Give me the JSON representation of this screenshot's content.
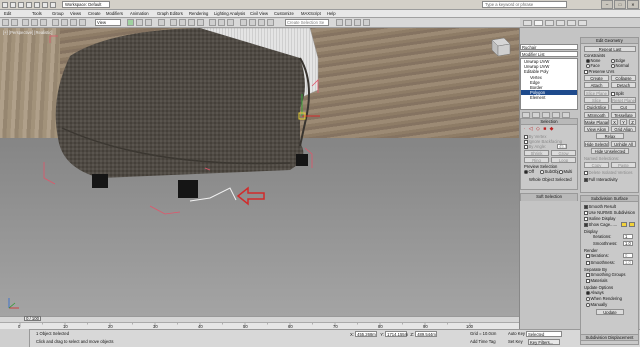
{
  "titlebar": {
    "workspace": "Workspace: Default",
    "title": "",
    "search_placeholder": "Type a keyword or phrase",
    "win_buttons": [
      "–",
      "□",
      "✕"
    ]
  },
  "menu": [
    "Edit",
    "Tools",
    "Group",
    "Views",
    "Create",
    "Modifiers",
    "Animation",
    "Graph Editors",
    "Rendering",
    "Lighting Analysis",
    "Civil View",
    "Customize",
    "MAXScript",
    "Help"
  ],
  "toolbar": {
    "view_dropdown": "View",
    "selection_set": "Create Selection Se"
  },
  "viewport": {
    "label": "[+] [Perspective] [Realistic]"
  },
  "time": {
    "slider_label": "0 / 100",
    "ruler_ticks": [
      "0",
      "10",
      "20",
      "30",
      "40",
      "50",
      "60",
      "70",
      "80",
      "90",
      "100"
    ]
  },
  "status": {
    "objects_selected": "1 Object Selected",
    "prompt": "Click and drag to select and move objects",
    "x_label": "X:",
    "x_value": "455.268m",
    "y_label": "Y:",
    "y_value": "1714.155m",
    "z_label": "Z:",
    "z_value": "489.544m",
    "grid": "Grid = 10.0cm",
    "add_time_tag": "Add Time Tag",
    "auto_key": "Auto Key",
    "auto_key_value": "Selected",
    "set_key": "Set Key",
    "key_filters": "Key Filters...",
    "frame": "0"
  },
  "panel": {
    "object_name": "Ruchair",
    "modifier_list": "Modifier List",
    "stack": [
      {
        "label": "Unwrap UVW",
        "selected": false,
        "indent": 0
      },
      {
        "label": "Unwrap UVW",
        "selected": false,
        "indent": 0
      },
      {
        "label": "Editable Poly",
        "selected": false,
        "indent": 0
      },
      {
        "label": "Vertex",
        "selected": false,
        "indent": 1
      },
      {
        "label": "Edge",
        "selected": false,
        "indent": 1
      },
      {
        "label": "Border",
        "selected": false,
        "indent": 1
      },
      {
        "label": "Polygon",
        "selected": true,
        "indent": 1
      },
      {
        "label": "Element",
        "selected": false,
        "indent": 1
      }
    ],
    "edit_geometry": {
      "header": "Edit Geometry",
      "repeat_last": "Repeat Last",
      "constraints": "Constraints",
      "none": "None",
      "edge": "Edge",
      "face": "Face",
      "normal": "Normal",
      "preserve_uvs": "Preserve UVs",
      "create": "Create",
      "collapse": "Collapse",
      "attach": "Attach",
      "detach": "Detach",
      "slice_plane": "Slice Plane",
      "split": "Split",
      "slice": "Slice",
      "reset_plane": "Reset Plane",
      "quickslice": "QuickSlice",
      "cut": "Cut",
      "msmooth": "MSmooth",
      "tessellate": "Tessellate",
      "make_planar": "Make Planar",
      "x": "X",
      "y": "Y",
      "z": "Z",
      "view_align": "View Align",
      "grid_align": "Grid Align",
      "relax": "Relax",
      "hide_selected": "Hide Selected",
      "unhide_all": "Unhide All",
      "hide_unselected": "Hide Unselected",
      "named_selections": "Named Selections:",
      "copy": "Copy",
      "paste": "Paste",
      "delete_isolated": "Delete Isolated Vertices",
      "full_interactivity": "Full Interactivity"
    },
    "selection": {
      "header": "Selection",
      "by_vertex": "By Vertex",
      "ignore_backfacing": "Ignore Backfacing",
      "by_angle": "By Angle:",
      "angle_value": "45.0",
      "shrink": "Shrink",
      "grow": "Grow",
      "ring": "Ring",
      "loop": "Loop",
      "preview_selection": "Preview Selection",
      "off": "Off",
      "subobj": "SubObj",
      "multi": "Multi",
      "whole_object": "Whole Object Selected"
    },
    "soft_selection": "Soft Selection",
    "subdivision": {
      "header": "Subdivision Surface",
      "smooth_result": "Smooth Result",
      "use_nurms": "Use NURMS Subdivision",
      "isoline": "Isoline Display",
      "show_cage": "Show Cage......",
      "display": "Display",
      "iterations_label": "Iterations:",
      "iterations_value": "1",
      "smoothness_label": "Smoothness:",
      "smoothness_value": "1.0",
      "render": "Render",
      "r_iterations_value": "0",
      "r_smoothness_value": "1.0",
      "separate_by": "Separate By",
      "smoothing_groups": "Smoothing Groups",
      "materials": "Materials",
      "update_options": "Update Options",
      "always": "Always",
      "when_rendering": "When Rendering",
      "manually": "Manually",
      "update": "Update"
    },
    "subdivision_displacement": "Subdivision Displacement"
  },
  "colors": {
    "selection_box": "#e0566a",
    "arrow": "#d22a2a",
    "cage_yellow": "#f2d23a"
  }
}
